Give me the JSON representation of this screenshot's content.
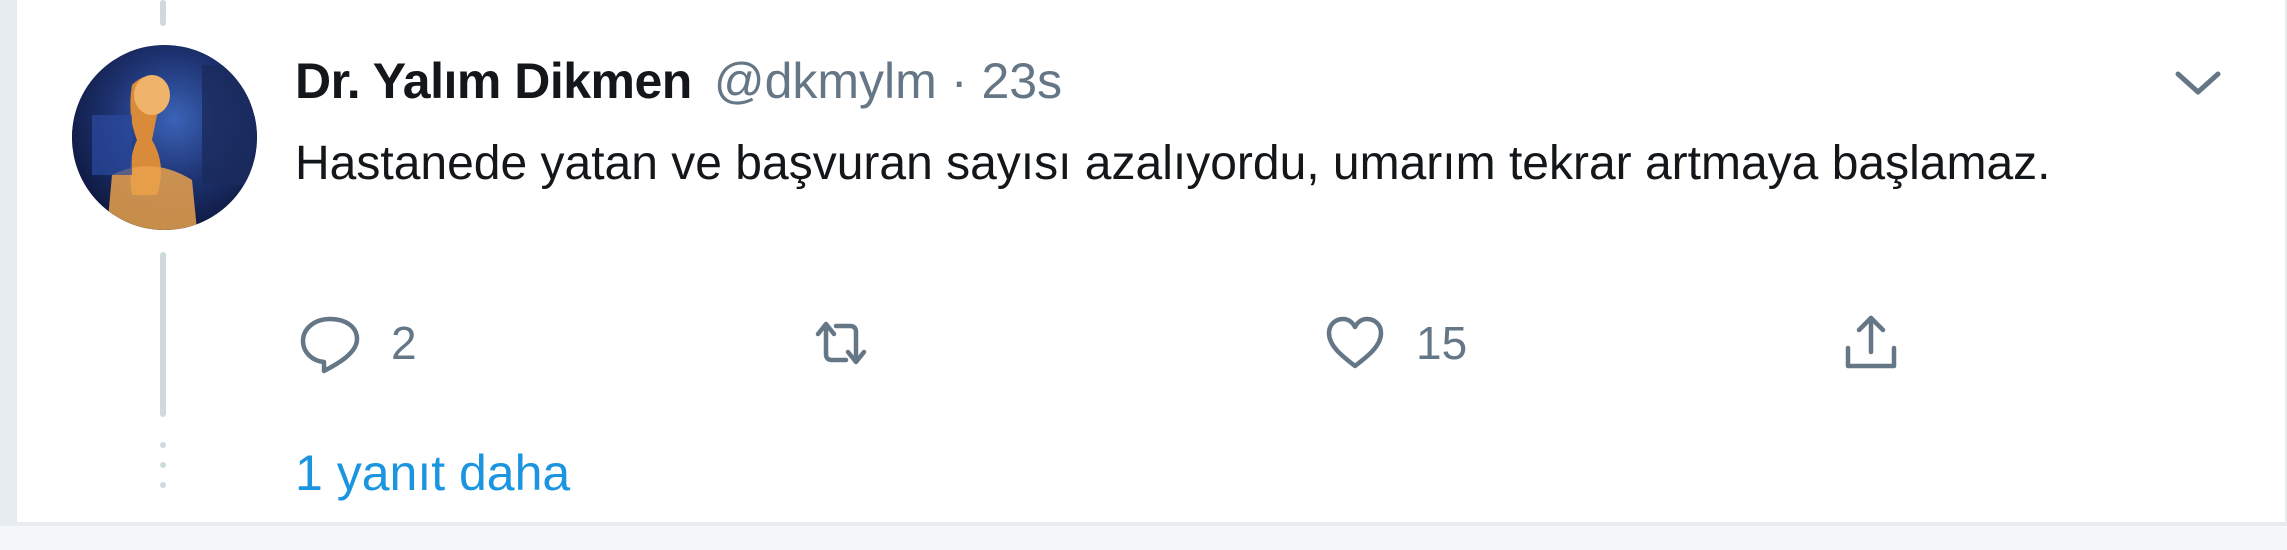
{
  "tweet": {
    "display_name": "Dr. Yalım Dikmen",
    "handle": "@dkmylm",
    "separator": "·",
    "timestamp": "23s",
    "text": "Hastanede yatan ve başvuran sayısı azalıyordu, umarım tekrar artmaya başlamaz.",
    "avatar_icon": "profile-photo",
    "menu_icon": "chevron-down-icon"
  },
  "actions": {
    "reply": {
      "icon": "reply-bubble-icon",
      "count": "2"
    },
    "retweet": {
      "icon": "retweet-icon",
      "count": ""
    },
    "like": {
      "icon": "heart-icon",
      "count": "15"
    },
    "share": {
      "icon": "share-icon"
    }
  },
  "thread": {
    "more_replies_label": "1 yanıt daha"
  },
  "colors": {
    "text_primary": "#14171a",
    "text_secondary": "#657786",
    "link": "#1b95e0",
    "thread_line": "#cfd9de",
    "border": "#e6ecf0"
  }
}
